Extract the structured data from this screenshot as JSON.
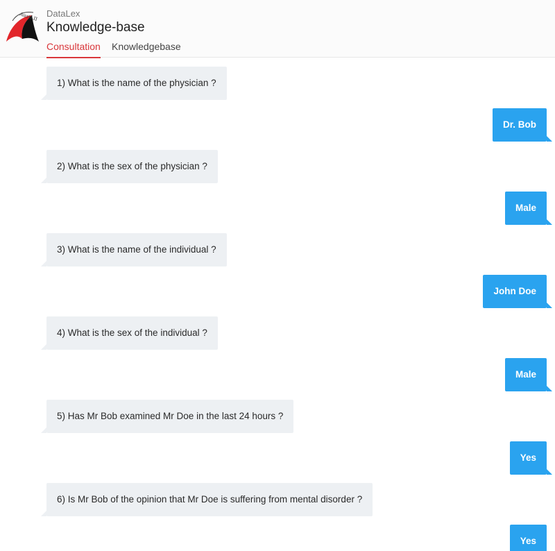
{
  "header": {
    "app_name": "DataLex",
    "title": "Knowledge-base",
    "logo_text": "AustLII",
    "tabs": [
      {
        "label": "Consultation",
        "active": true
      },
      {
        "label": "Knowledgebase",
        "active": false
      }
    ]
  },
  "colors": {
    "accent": "#d9363a",
    "answer_bubble": "#2aa3ef",
    "question_bubble": "#edf0f3"
  },
  "conversation": [
    {
      "question": "1) What is the name of the physician ?",
      "answer": "Dr. Bob"
    },
    {
      "question": "2) What is the sex of the physician ?",
      "answer": "Male"
    },
    {
      "question": "3) What is the name of the individual ?",
      "answer": "John Doe"
    },
    {
      "question": "4) What is the sex of the individual ?",
      "answer": "Male"
    },
    {
      "question": "5) Has Mr Bob examined Mr Doe in the last 24 hours ?",
      "answer": "Yes"
    },
    {
      "question": "6) Is Mr Bob of the opinion that Mr Doe is suffering from mental disorder ?",
      "answer": "Yes"
    }
  ]
}
